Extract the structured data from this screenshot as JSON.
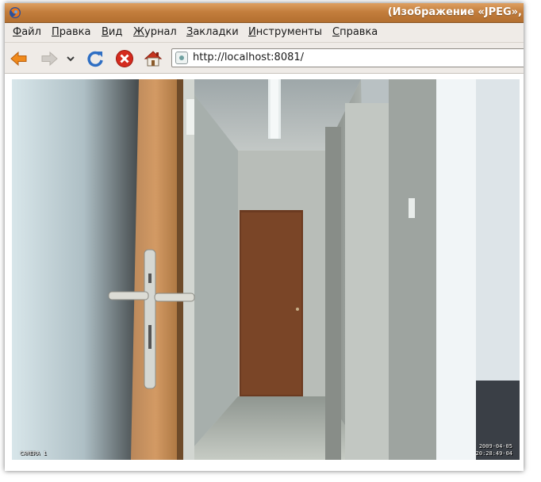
{
  "window": {
    "title": "(Изображение «JPEG»,"
  },
  "menubar": {
    "items": [
      {
        "accel": "Ф",
        "rest": "айл"
      },
      {
        "accel": "П",
        "rest": "равка"
      },
      {
        "accel": "В",
        "rest": "ид"
      },
      {
        "accel": "Ж",
        "rest": "урнал"
      },
      {
        "accel": "З",
        "rest": "акладки"
      },
      {
        "accel": "И",
        "rest": "нструменты"
      },
      {
        "accel": "С",
        "rest": "правка"
      }
    ]
  },
  "toolbar": {
    "icons": [
      "back-arrow-icon",
      "forward-arrow-icon",
      "history-dropdown-icon",
      "reload-icon",
      "stop-icon",
      "home-icon"
    ],
    "url": "http://localhost:8081/"
  },
  "camera": {
    "label": "CAMERA 1",
    "date": "2009-04-05",
    "time": "20:28:49-04"
  },
  "colors": {
    "titlebar": "#c37e3d",
    "menubar": "#efebe7",
    "stop_red": "#d42a1e",
    "back_orange": "#f08a1c",
    "reload_blue": "#2f6fc4"
  }
}
